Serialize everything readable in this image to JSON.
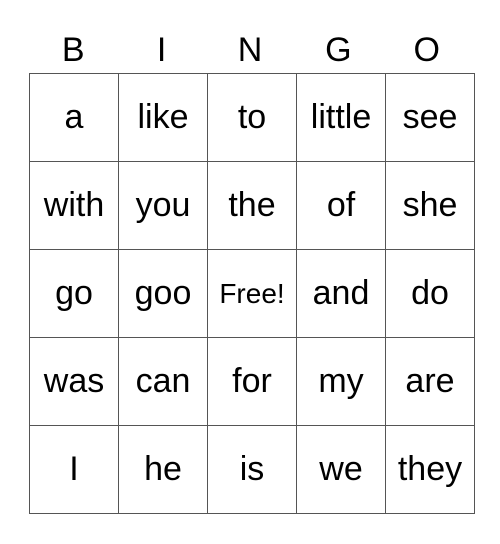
{
  "header": [
    "B",
    "I",
    "N",
    "G",
    "O"
  ],
  "rows": [
    [
      "a",
      "like",
      "to",
      "little",
      "see"
    ],
    [
      "with",
      "you",
      "the",
      "of",
      "she"
    ],
    [
      "go",
      "goo",
      "Free!",
      "and",
      "do"
    ],
    [
      "was",
      "can",
      "for",
      "my",
      "are"
    ],
    [
      "I",
      "he",
      "is",
      "we",
      "they"
    ]
  ]
}
